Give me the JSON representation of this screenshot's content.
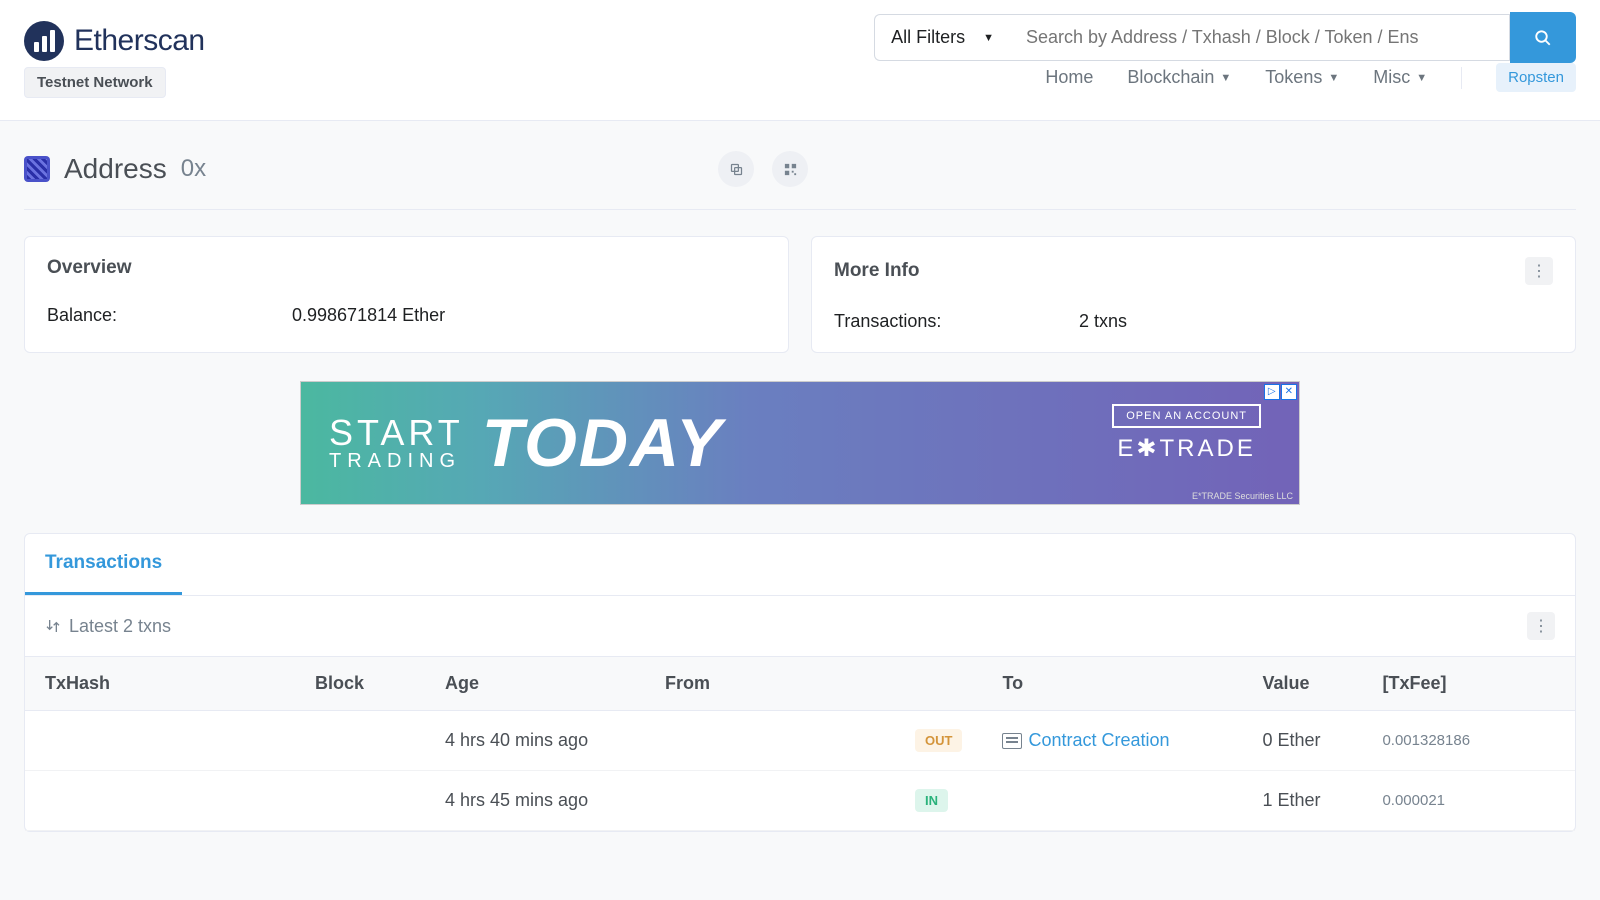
{
  "header": {
    "logo_text": "Etherscan",
    "testnet_label": "Testnet Network",
    "filter_label": "All Filters",
    "search_placeholder": "Search by Address / Txhash / Block / Token / Ens",
    "nav": [
      "Home",
      "Blockchain",
      "Tokens",
      "Misc"
    ],
    "network_badge": "Ropsten"
  },
  "title": {
    "label": "Address",
    "value": "0x"
  },
  "overview": {
    "title": "Overview",
    "balance_label": "Balance:",
    "balance_value": "0.998671814 Ether"
  },
  "moreinfo": {
    "title": "More Info",
    "tx_label": "Transactions:",
    "tx_value": "2 txns"
  },
  "ad": {
    "line1": "START",
    "line1b": "TRADING",
    "line2": "TODAY",
    "cta": "OPEN AN ACCOUNT",
    "brand": "E✱TRADE",
    "footer": "E*TRADE Securities LLC"
  },
  "tx": {
    "tab": "Transactions",
    "sort_label": "Latest 2 txns",
    "columns": {
      "hash": "TxHash",
      "block": "Block",
      "age": "Age",
      "from": "From",
      "to": "To",
      "value": "Value",
      "fee": "[TxFee]"
    },
    "rows": [
      {
        "hash": "",
        "block": "",
        "age": "4 hrs 40 mins ago",
        "from": "",
        "dir": "OUT",
        "to": "Contract Creation",
        "to_contract": true,
        "value": "0 Ether",
        "fee": "0.001328186"
      },
      {
        "hash": "",
        "block": "",
        "age": "4 hrs 45 mins ago",
        "from": "",
        "dir": "IN",
        "to": "",
        "to_contract": false,
        "value": "1 Ether",
        "fee": "0.000021"
      }
    ]
  }
}
